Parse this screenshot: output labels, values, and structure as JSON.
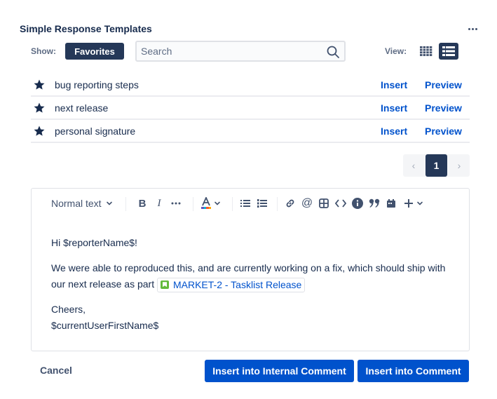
{
  "header": {
    "title": "Simple Response Templates",
    "more_icon": "ellipsis-icon"
  },
  "filters": {
    "show_label": "Show:",
    "show_selected": "Favorites",
    "search_placeholder": "Search",
    "search_value": "",
    "view_label": "View:",
    "view_options": [
      "grid",
      "list"
    ],
    "view_selected": "list"
  },
  "templates": [
    {
      "name": "bug reporting steps",
      "favorite": true,
      "insert": "Insert",
      "preview": "Preview"
    },
    {
      "name": "next release",
      "favorite": true,
      "insert": "Insert",
      "preview": "Preview"
    },
    {
      "name": "personal signature",
      "favorite": true,
      "insert": "Insert",
      "preview": "Preview"
    }
  ],
  "pagination": {
    "prev": "‹",
    "current": "1",
    "next": "›"
  },
  "editor": {
    "toolbar": {
      "text_style": "Normal text",
      "items": [
        "bold",
        "italic",
        "more-formatting",
        "text-color",
        "bullet-list",
        "numbered-list",
        "link",
        "mention",
        "table",
        "code",
        "info-panel",
        "quote",
        "date",
        "insert-more"
      ]
    },
    "content": {
      "greeting": "Hi $reporterName$!",
      "body_text": "We were able to reproduced this, and are currently working on a fix, which should ship with our next release as part",
      "issue_link": "MARKET-2 - Tasklist Release",
      "signoff": "Cheers,",
      "signature": "$currentUserFirstName$"
    }
  },
  "actions": {
    "cancel": "Cancel",
    "insert_internal": "Insert into Internal Comment",
    "insert_comment": "Insert into Comment"
  },
  "colors": {
    "primary": "#0052cc",
    "dark": "#253858",
    "text": "#172b4d",
    "issue_icon": "#63ba3c"
  }
}
